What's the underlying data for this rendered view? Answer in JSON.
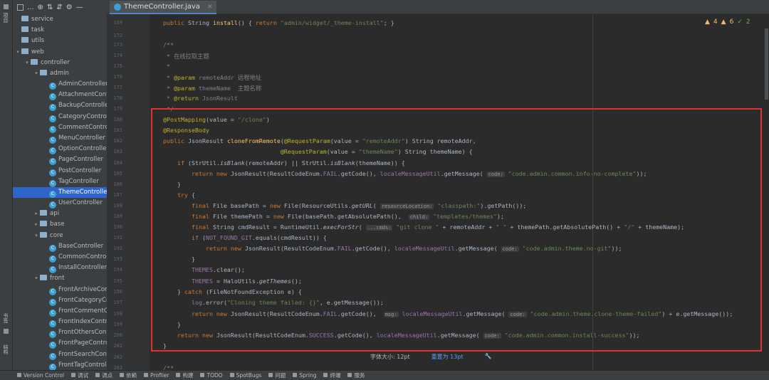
{
  "sidebar_strip": {
    "project_label": "项目",
    "bookmarks_label": "书签",
    "structure_label": "结构"
  },
  "toolbar": {
    "more": "..."
  },
  "tree": [
    {
      "label": "service",
      "type": "folder",
      "indent": 0,
      "arrow": ""
    },
    {
      "label": "task",
      "type": "folder",
      "indent": 0,
      "arrow": ""
    },
    {
      "label": "utils",
      "type": "folder",
      "indent": 0,
      "arrow": ""
    },
    {
      "label": "web",
      "type": "folder",
      "indent": 0,
      "arrow": "▾"
    },
    {
      "label": "controller",
      "type": "folder",
      "indent": 1,
      "arrow": "▾"
    },
    {
      "label": "admin",
      "type": "folder",
      "indent": 2,
      "arrow": "▾"
    },
    {
      "label": "AdminController",
      "type": "class",
      "indent": 3
    },
    {
      "label": "AttachmentContr",
      "type": "class",
      "indent": 3
    },
    {
      "label": "BackupController",
      "type": "class",
      "indent": 3
    },
    {
      "label": "CategoryControlle",
      "type": "class",
      "indent": 3
    },
    {
      "label": "CommentControll",
      "type": "class",
      "indent": 3
    },
    {
      "label": "MenuController",
      "type": "class",
      "indent": 3
    },
    {
      "label": "OptionController",
      "type": "class",
      "indent": 3
    },
    {
      "label": "PageController",
      "type": "class",
      "indent": 3
    },
    {
      "label": "PostController",
      "type": "class",
      "indent": 3
    },
    {
      "label": "TagController",
      "type": "class",
      "indent": 3
    },
    {
      "label": "ThemeController",
      "type": "class",
      "indent": 3,
      "selected": true
    },
    {
      "label": "UserController",
      "type": "class",
      "indent": 3
    },
    {
      "label": "api",
      "type": "folder",
      "indent": 2,
      "arrow": "▸"
    },
    {
      "label": "base",
      "type": "folder",
      "indent": 2,
      "arrow": "▸"
    },
    {
      "label": "core",
      "type": "folder",
      "indent": 2,
      "arrow": "▾"
    },
    {
      "label": "BaseController",
      "type": "class",
      "indent": 3
    },
    {
      "label": "CommonControlle",
      "type": "class",
      "indent": 3
    },
    {
      "label": "InstallController",
      "type": "class",
      "indent": 3
    },
    {
      "label": "front",
      "type": "folder",
      "indent": 2,
      "arrow": "▾"
    },
    {
      "label": "FrontArchiveCont",
      "type": "class",
      "indent": 3
    },
    {
      "label": "FrontCategoryCor",
      "type": "class",
      "indent": 3
    },
    {
      "label": "FrontCommentCo",
      "type": "class",
      "indent": 3
    },
    {
      "label": "FrontIndexContro",
      "type": "class",
      "indent": 3
    },
    {
      "label": "FrontOthersContro",
      "type": "class",
      "indent": 3
    },
    {
      "label": "FrontPageControl",
      "type": "class",
      "indent": 3
    },
    {
      "label": "FrontSearchContr",
      "type": "class",
      "indent": 3
    },
    {
      "label": "FrontTagControlle",
      "type": "class",
      "indent": 3
    }
  ],
  "editor": {
    "tab_label": "ThemeController.java",
    "inspections": {
      "warnings_a": "4",
      "warnings_b": "6",
      "ok": "2"
    },
    "lines": [
      {
        "n": "169",
        "html": "<span class='kw'>public</span> String <span class='mt'>install</span>() { <span class='kw'>return</span> <span class='st'>\"admin/widget/_theme-install\"</span>; }"
      },
      {
        "n": "172",
        "html": ""
      },
      {
        "n": "173",
        "html": "<span class='cm'>/**</span>"
      },
      {
        "n": "174",
        "html": "<span class='cm'> * 在线拉取主题</span>"
      },
      {
        "n": "175",
        "html": "<span class='cm'> *</span>"
      },
      {
        "n": "176",
        "html": "<span class='cm'> * </span><span class='an'>@param</span><span class='cm'> remoteAddr 远程地址</span>"
      },
      {
        "n": "177",
        "html": "<span class='cm'> * </span><span class='an'>@param</span><span class='cm'> themeName  主题名称</span>"
      },
      {
        "n": "178",
        "html": "<span class='cm'> * </span><span class='an'>@return</span><span class='cm'> JsonResult</span>"
      },
      {
        "n": "179",
        "html": "<span class='cm'> */</span>"
      },
      {
        "n": "180",
        "html": "<span class='an'>@PostMapping</span>(value = <span class='st'>\"/clone\"</span>)"
      },
      {
        "n": "181",
        "html": "<span class='an'>@ResponseBody</span>"
      },
      {
        "n": "182",
        "html": "<span class='kw'>public</span> JsonResult <span class='mt'>cloneFromRemote</span>(<span class='an'>@RequestParam</span>(value = <span class='st'>\"remoteAddr\"</span>) String remoteAddr,"
      },
      {
        "n": "183",
        "html": "                                 <span class='an'>@RequestParam</span>(value = <span class='st'>\"themeName\"</span>) String themeName) {"
      },
      {
        "n": "184",
        "html": "    <span class='kw'>if</span> (StrUtil.<i>isBlank</i>(remoteAddr) || StrUtil.<i>isBlank</i>(themeName)) {"
      },
      {
        "n": "185",
        "html": "        <span class='kw'>return new</span> JsonResult(ResultCodeEnum.<span class='fld'>FAIL</span>.getCode(), <span class='fld'>localeMessageUtil</span>.getMessage( <span class='hint'>code:</span> <span class='st'>\"code.admin.common.info-no-complete\"</span>));"
      },
      {
        "n": "186",
        "html": "    }"
      },
      {
        "n": "187",
        "html": "    <span class='kw'>try</span> {"
      },
      {
        "n": "188",
        "html": "        <span class='kw'>final</span> File basePath = <span class='kw'>new</span> File(ResourceUtils.<i>getURL</i>( <span class='hint'>resourceLocation:</span> <span class='st'>\"classpath:\"</span>).getPath());"
      },
      {
        "n": "189",
        "html": "        <span class='kw'>final</span> File themePath = <span class='kw'>new</span> File(basePath.getAbsolutePath(),  <span class='hint'>child:</span> <span class='st'>\"templates/themes\"</span>);"
      },
      {
        "n": "190",
        "html": "        <span class='kw'>final</span> String cmdResult = RuntimeUtil.<i>execForStr</i>( <span class='hint'>...cmds:</span> <span class='st'>\"git clone \"</span> + remoteAddr + <span class='st'>\" \"</span> + themePath.getAbsolutePath() + <span class='st'>\"/\"</span> + themeName);"
      },
      {
        "n": "191",
        "html": "        <span class='kw'>if</span> (<span class='fld'>NOT_FOUND_GIT</span>.equals(cmdResult)) {"
      },
      {
        "n": "192",
        "html": "            <span class='kw'>return new</span> JsonResult(ResultCodeEnum.<span class='fld'>FAIL</span>.getCode(), <span class='fld'>localeMessageUtil</span>.getMessage( <span class='hint'>code:</span> <span class='st'>\"code.admin.theme.no-git\"</span>));"
      },
      {
        "n": "193",
        "html": "        }"
      },
      {
        "n": "194",
        "html": "        <span class='fld'>THEMES</span>.clear();"
      },
      {
        "n": "195",
        "html": "        <span class='fld'>THEMES</span> = HaloUtils.<i>getThemes</i>();"
      },
      {
        "n": "196",
        "html": "    } <span class='kw'>catch</span> (FileNotFoundException e) {"
      },
      {
        "n": "197",
        "html": "        <span class='fld'>log</span>.error(<span class='st'>\"Cloning theme failed: {}\"</span>, e.getMessage());"
      },
      {
        "n": "198",
        "html": "        <span class='kw'>return new</span> JsonResult(ResultCodeEnum.<span class='fld'>FAIL</span>.getCode(),  <span class='hint'>msg:</span> <span class='fld'>localeMessageUtil</span>.getMessage( <span class='hint'>code:</span> <span class='st'>\"code.admin.theme.clone-theme-failed\"</span>) + e.getMessage());"
      },
      {
        "n": "199",
        "html": "    }"
      },
      {
        "n": "200",
        "html": "    <span class='kw'>return new</span> JsonResult(ResultCodeEnum.<span class='fld'>SUCCESS</span>.getCode(), <span class='fld'>localeMessageUtil</span>.getMessage( <span class='hint'>code:</span> <span class='st'>\"code.admin.common.install-success\"</span>));"
      },
      {
        "n": "201",
        "html": "}"
      },
      {
        "n": "202",
        "html": ""
      },
      {
        "n": "203",
        "html": "<span class='cm'>/**</span>"
      }
    ]
  },
  "font_popup": {
    "size_text": "字体大小: 12pt",
    "reset_text": "重置为 13pt"
  },
  "statusbar": [
    "Version Control",
    "调试",
    "调点",
    "依赖",
    "Profiler",
    "构建",
    "TODO",
    "SpotBugs",
    "问题",
    "Spring",
    "终端",
    "服务"
  ],
  "colors": {
    "selection": "#2f65ca",
    "highlight_box": "#e0312d",
    "tab_underline": "#4a88c7"
  }
}
